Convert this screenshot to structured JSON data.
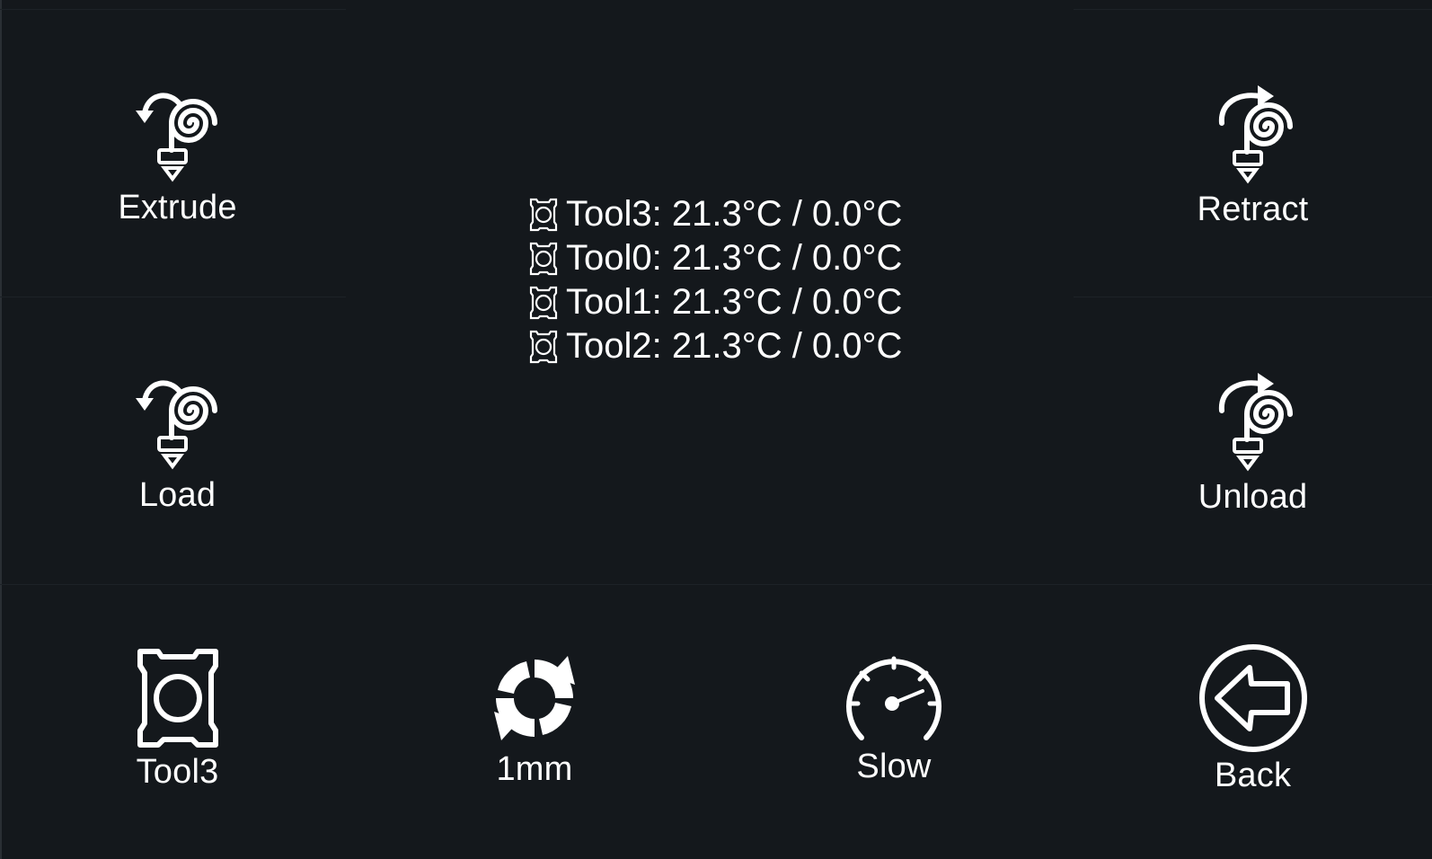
{
  "buttons": {
    "extrude": "Extrude",
    "retract": "Retract",
    "load": "Load",
    "unload": "Unload",
    "tool": "Tool3",
    "distance": "1mm",
    "speed": "Slow",
    "back": "Back"
  },
  "temperatures": [
    {
      "text": "Tool3: 21.3°C / 0.0°C"
    },
    {
      "text": "Tool0: 21.3°C / 0.0°C"
    },
    {
      "text": "Tool1: 21.3°C / 0.0°C"
    },
    {
      "text": "Tool2: 21.3°C / 0.0°C"
    }
  ],
  "colors": {
    "background": "#14181c",
    "foreground": "#ffffff",
    "divider": "#1d2227"
  },
  "icons": {
    "extrude": "extrude-icon",
    "retract": "retract-icon",
    "load": "load-icon",
    "unload": "unload-icon",
    "tool": "extruder-tool-icon",
    "distance": "refresh-cycle-icon",
    "speed": "speedometer-icon",
    "back": "back-arrow-icon"
  }
}
